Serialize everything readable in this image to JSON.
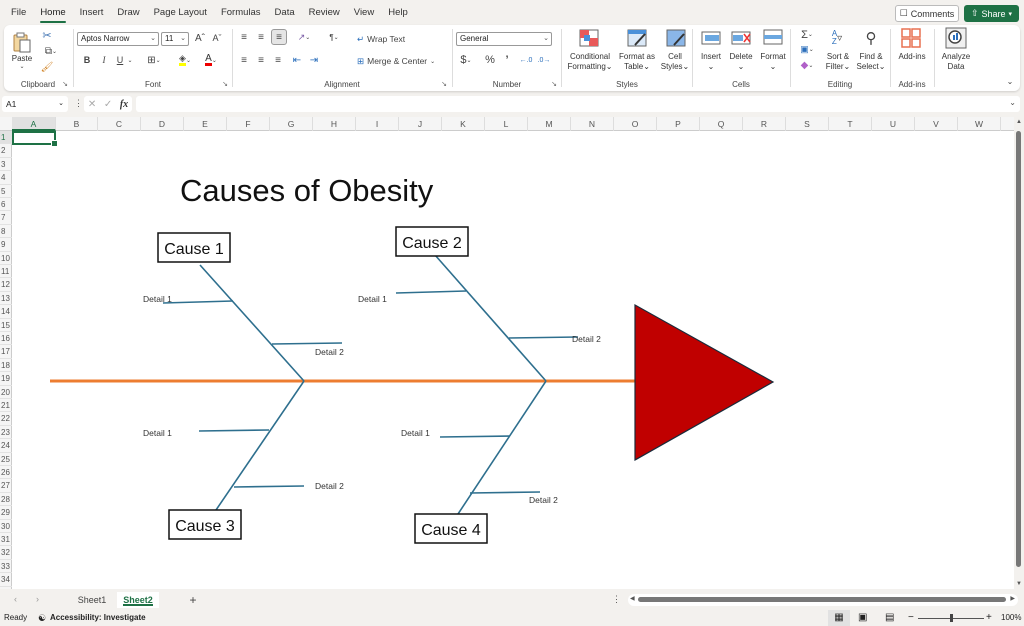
{
  "menu": {
    "tabs": [
      "File",
      "Home",
      "Insert",
      "Draw",
      "Page Layout",
      "Formulas",
      "Data",
      "Review",
      "View",
      "Help"
    ],
    "active": "Home",
    "comments_label": "Comments",
    "share_label": "Share"
  },
  "ribbon": {
    "clipboard": {
      "label": "Clipboard",
      "paste": "Paste"
    },
    "font": {
      "label": "Font",
      "font_name": "Aptos Narrow",
      "font_size": "11",
      "bold": "B",
      "italic": "I",
      "underline": "U",
      "grow": "Aˆ",
      "shrink": "Aˇ"
    },
    "alignment": {
      "label": "Alignment",
      "wrap_text": "Wrap Text",
      "merge_center": "Merge & Center"
    },
    "number": {
      "label": "Number",
      "format": "General",
      "currency": "$",
      "percent": "%",
      "comma": "9"
    },
    "styles": {
      "label": "Styles",
      "conditional_1": "Conditional",
      "conditional_2": "Formatting",
      "format_table_1": "Format as",
      "format_table_2": "Table",
      "cell_styles_1": "Cell",
      "cell_styles_2": "Styles"
    },
    "cells": {
      "label": "Cells",
      "insert": "Insert",
      "delete": "Delete",
      "format": "Format"
    },
    "editing": {
      "label": "Editing",
      "sort_1": "Sort &",
      "sort_2": "Filter",
      "find_1": "Find &",
      "find_2": "Select"
    },
    "addins": {
      "label": "Add-ins",
      "addins": "Add-ins"
    },
    "analyze": {
      "label_1": "Analyze",
      "label_2": "Data"
    }
  },
  "formula_bar": {
    "name_box": "A1",
    "fx": "fx",
    "formula": ""
  },
  "grid": {
    "columns": [
      "A",
      "B",
      "C",
      "D",
      "E",
      "F",
      "G",
      "H",
      "I",
      "J",
      "K",
      "L",
      "M",
      "N",
      "O",
      "P",
      "Q",
      "R",
      "S",
      "T",
      "U",
      "V",
      "W"
    ],
    "rows": [
      "1",
      "2",
      "3",
      "4",
      "5",
      "6",
      "7",
      "8",
      "9",
      "10",
      "11",
      "12",
      "13",
      "14",
      "15",
      "16",
      "17",
      "18",
      "19",
      "20",
      "21",
      "22",
      "23",
      "24",
      "25",
      "26",
      "27",
      "28",
      "29",
      "30",
      "31",
      "32",
      "33",
      "34"
    ],
    "selected_cell": "A1"
  },
  "diagram": {
    "title": "Causes of Obesity",
    "causes": [
      {
        "label": "Cause 1",
        "detail1": "Detail 1",
        "detail2": "Detail 2"
      },
      {
        "label": "Cause 2",
        "detail1": "Detail 1",
        "detail2": "Detail 2"
      },
      {
        "label": "Cause 3",
        "detail1": "Detail 1",
        "detail2": "Detail 2"
      },
      {
        "label": "Cause 4",
        "detail1": "Detail 1",
        "detail2": "Detail 2"
      }
    ],
    "spine_color": "#ed7d31",
    "bone_color": "#2e6f8e",
    "head_color": "#c00000"
  },
  "sheets": {
    "tabs": [
      "Sheet1",
      "Sheet2"
    ],
    "active": "Sheet2",
    "add": "+"
  },
  "status": {
    "ready": "Ready",
    "accessibility": "Accessibility: Investigate",
    "zoom": "100%"
  }
}
